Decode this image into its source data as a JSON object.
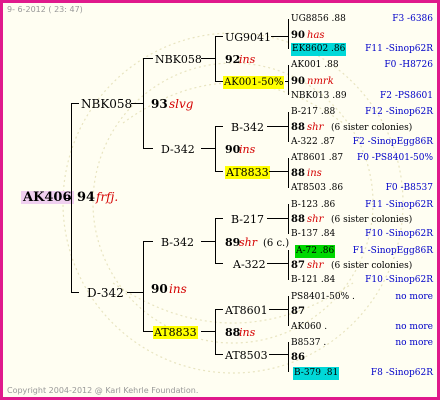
{
  "header": "9- 6-2012 ( 23: 47)",
  "footer": "Copyright 2004-2012 @ Karl Kehrle Foundation.",
  "root": {
    "name": "AK406",
    "num": "94",
    "tag": "frfj."
  },
  "g1": {
    "top": "NBK058",
    "bottom": "D-342"
  },
  "g2": {
    "a": {
      "name": "NBK058",
      "num": "93",
      "tag": "slvg"
    },
    "b": {
      "name": "D-342"
    },
    "c": {
      "name": "B-342",
      "num": "89",
      "tag": "shr",
      "extra": "(6 c.)"
    },
    "d": {
      "name": "D-342",
      "num": "90",
      "tag": "ins"
    },
    "e": {
      "name": "AT8833"
    }
  },
  "g3": {
    "r1": {
      "name": "UG9041",
      "num": "92",
      "tag": "ins"
    },
    "r2": {
      "name": "AK001-50%"
    },
    "r3": {
      "name": "B-342",
      "num": "90",
      "tag": "ins"
    },
    "r4": {
      "name": "AT8833"
    },
    "r5": {
      "name": "B-217",
      "num": "89",
      "tag": "shr",
      "extra": "(6 c.)"
    },
    "r6": {
      "name": "A-322"
    },
    "r7": {
      "name": "AT8601",
      "num": "88",
      "tag": "ins"
    },
    "r8": {
      "name": "AT8503"
    }
  },
  "g4": [
    {
      "line1": "UG8856 .88",
      "line1r": "F3 -6386",
      "mid": "90",
      "midtag": "has",
      "line3": "EK8602 .86",
      "line3r": "F11 -Sinop62R"
    },
    {
      "line1": "AK001 .88",
      "line1r": "F0 -H8726",
      "mid": "90",
      "midtag": "nmrk",
      "line3": "NBK013 .89",
      "line3r": "F2 -PS8601"
    },
    {
      "line1": "B-217 .88",
      "line1r": "F12 -Sinop62R",
      "mid": "88",
      "midtag": "shr",
      "midextra": "(6 sister colonies)",
      "line3": "A-322 .87",
      "line3r": "F2 -SinopEgg86R"
    },
    {
      "line1": "AT8601 .87",
      "line1r": "F0 -PS8401-50%",
      "mid": "88",
      "midtag": "ins",
      "line3": "AT8503 .86",
      "line3r": "F0 -B8537"
    },
    {
      "line1": "B-123 .86",
      "line1r": "F11 -Sinop62R",
      "mid": "88",
      "midtag": "shr",
      "midextra": "(6 sister colonies)",
      "line3": "B-137 .84",
      "line3r": "F10 -Sinop62R"
    },
    {
      "line1": "A-72 .86",
      "line1r": "F1 -SinopEgg86R",
      "mid": "87",
      "midtag": "shr",
      "midextra": "(6 sister colonies)",
      "line3": "B-121 .84",
      "line3r": "F10 -Sinop62R"
    },
    {
      "line1": "PS8401-50% .",
      "line1r": "no more",
      "mid": "87",
      "midtag": "",
      "line3": "AK060 .",
      "line3r": "no more"
    },
    {
      "line1": "B8537 .",
      "line1r": "no more",
      "mid": "86",
      "midtag": "",
      "line3": "B-379 .81",
      "line3r": "F8 -Sinop62R"
    }
  ],
  "colors": {
    "border": "#e01a8c",
    "highlight_yellow": "#ffff00",
    "highlight_cyan": "#00d8d8",
    "highlight_green": "#00d800",
    "root_bg": "#f0d0f0",
    "tag_red": "#d40000",
    "right_blue": "#0000c8"
  }
}
